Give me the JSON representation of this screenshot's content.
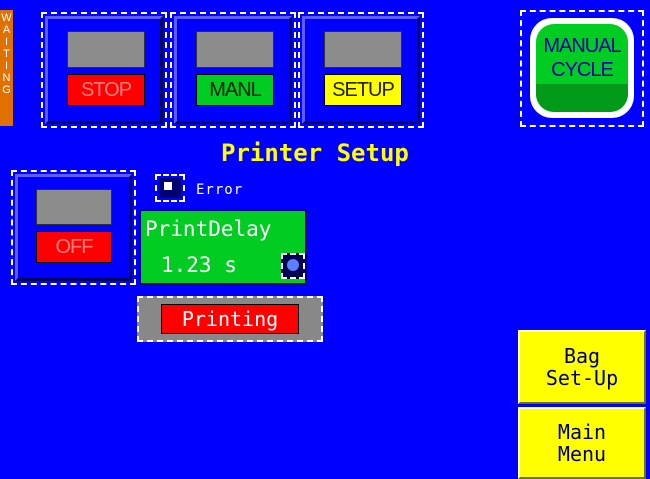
{
  "status": {
    "text": "WAITING",
    "letters": [
      "W",
      "A",
      "I",
      "T",
      "I",
      "N",
      "G"
    ]
  },
  "top_buttons": [
    {
      "label": "STOP"
    },
    {
      "label": "MANL"
    },
    {
      "label": "SETUP"
    }
  ],
  "manual_cycle": {
    "line1": "MANUAL",
    "line2": "CYCLE"
  },
  "page_title": "Printer Setup",
  "error": {
    "label": "Error"
  },
  "off_button": {
    "label": "OFF"
  },
  "print_delay": {
    "label": "PrintDelay",
    "value": "1.23",
    "unit": "s"
  },
  "printing": {
    "label": "Printing"
  },
  "bag_setup": {
    "line1": "Bag",
    "line2": "Set-Up"
  },
  "main_menu": {
    "line1": "Main",
    "line2": "Menu"
  }
}
